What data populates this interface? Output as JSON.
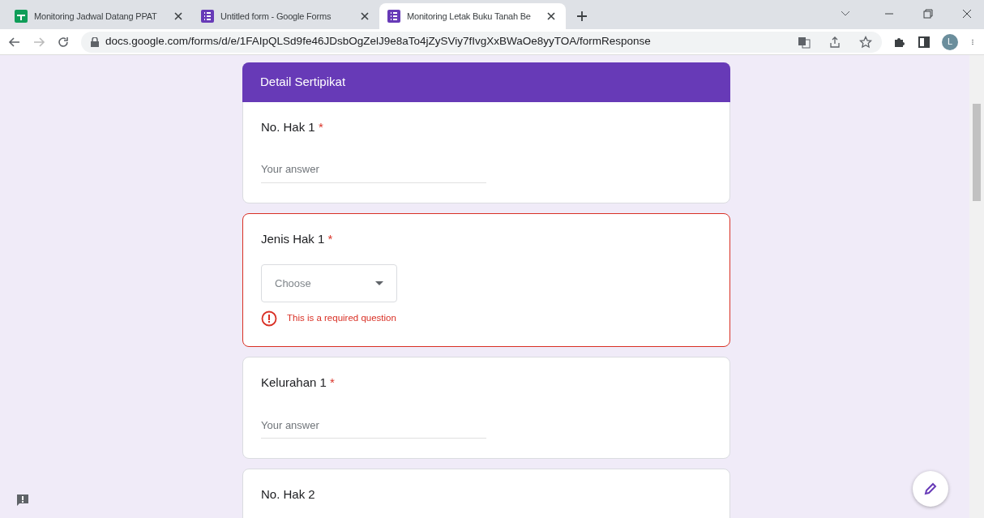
{
  "browser": {
    "tabs": [
      {
        "title": "Monitoring Jadwal Datang PPAT",
        "selected": false
      },
      {
        "title": "Untitled form - Google Forms",
        "selected": false
      },
      {
        "title": "Monitoring Letak Buku Tanah Be",
        "selected": true
      }
    ],
    "url": "docs.google.com/forms/d/e/1FAIpQLSd9fe46JDsbOgZelJ9e8aTo4jZySViy7fIvgXxBWaOe8yyTOA/formResponse",
    "profile_initial": "L"
  },
  "form": {
    "section_title": "Detail Sertipikat",
    "questions": [
      {
        "title": "No. Hak 1",
        "required_mark": "*",
        "kind": "text",
        "placeholder": "Your answer",
        "error": false
      },
      {
        "title": "Jenis Hak 1",
        "required_mark": "*",
        "kind": "dropdown",
        "placeholder": "Choose",
        "error": true,
        "error_message": "This is a required question"
      },
      {
        "title": "Kelurahan 1",
        "required_mark": "*",
        "kind": "text",
        "placeholder": "Your answer",
        "error": false
      },
      {
        "title": "No. Hak 2",
        "kind": "text",
        "error": false
      }
    ]
  }
}
